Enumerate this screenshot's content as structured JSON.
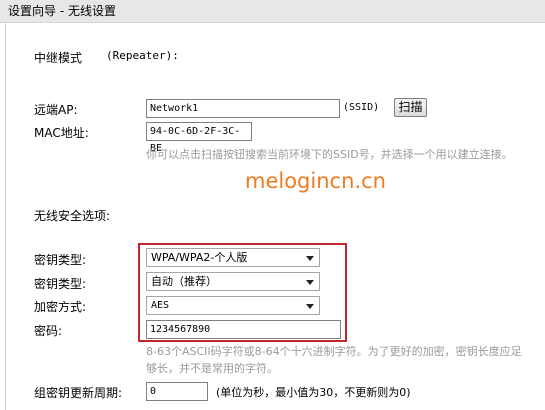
{
  "header": {
    "title": "设置向导 - 无线设置"
  },
  "form": {
    "mode_label": "中继模式",
    "mode_value": "(Repeater):",
    "remote_ap_label": "远端AP:",
    "ssid_value": "Network1",
    "ssid_suffix": "(SSID)",
    "scan_button": "扫描",
    "mac_label": "MAC地址:",
    "mac_value": "94-0C-6D-2F-3C-BE",
    "scan_hint": "你可以点击扫描按钮搜索当前环境下的SSID号，并选择一个用以建立连接。",
    "security_section": "无线安全选项:",
    "key_type_label_1": "密钥类型:",
    "key_type_value_1": "WPA/WPA2-个人版",
    "key_type_label_2": "密钥类型:",
    "key_type_value_2": "自动（推荐）",
    "encryption_label": "加密方式:",
    "encryption_value": "AES",
    "password_label": "密码:",
    "password_value": "1234567890",
    "password_hint": "8-63个ASCII码字符或8-64个十六进制字符。为了更好的加密，密钥长度应足够长，并不是常用的字符。",
    "rekey_label": "组密钥更新周期:",
    "rekey_value": "0",
    "rekey_hint": "(单位为秒，最小值为30，不更新则为0)"
  },
  "watermark": "melogincn.cn",
  "colors": {
    "highlight_border": "#c0282e",
    "watermark": "#f07b1e",
    "hint_text": "#9a9a9a"
  }
}
